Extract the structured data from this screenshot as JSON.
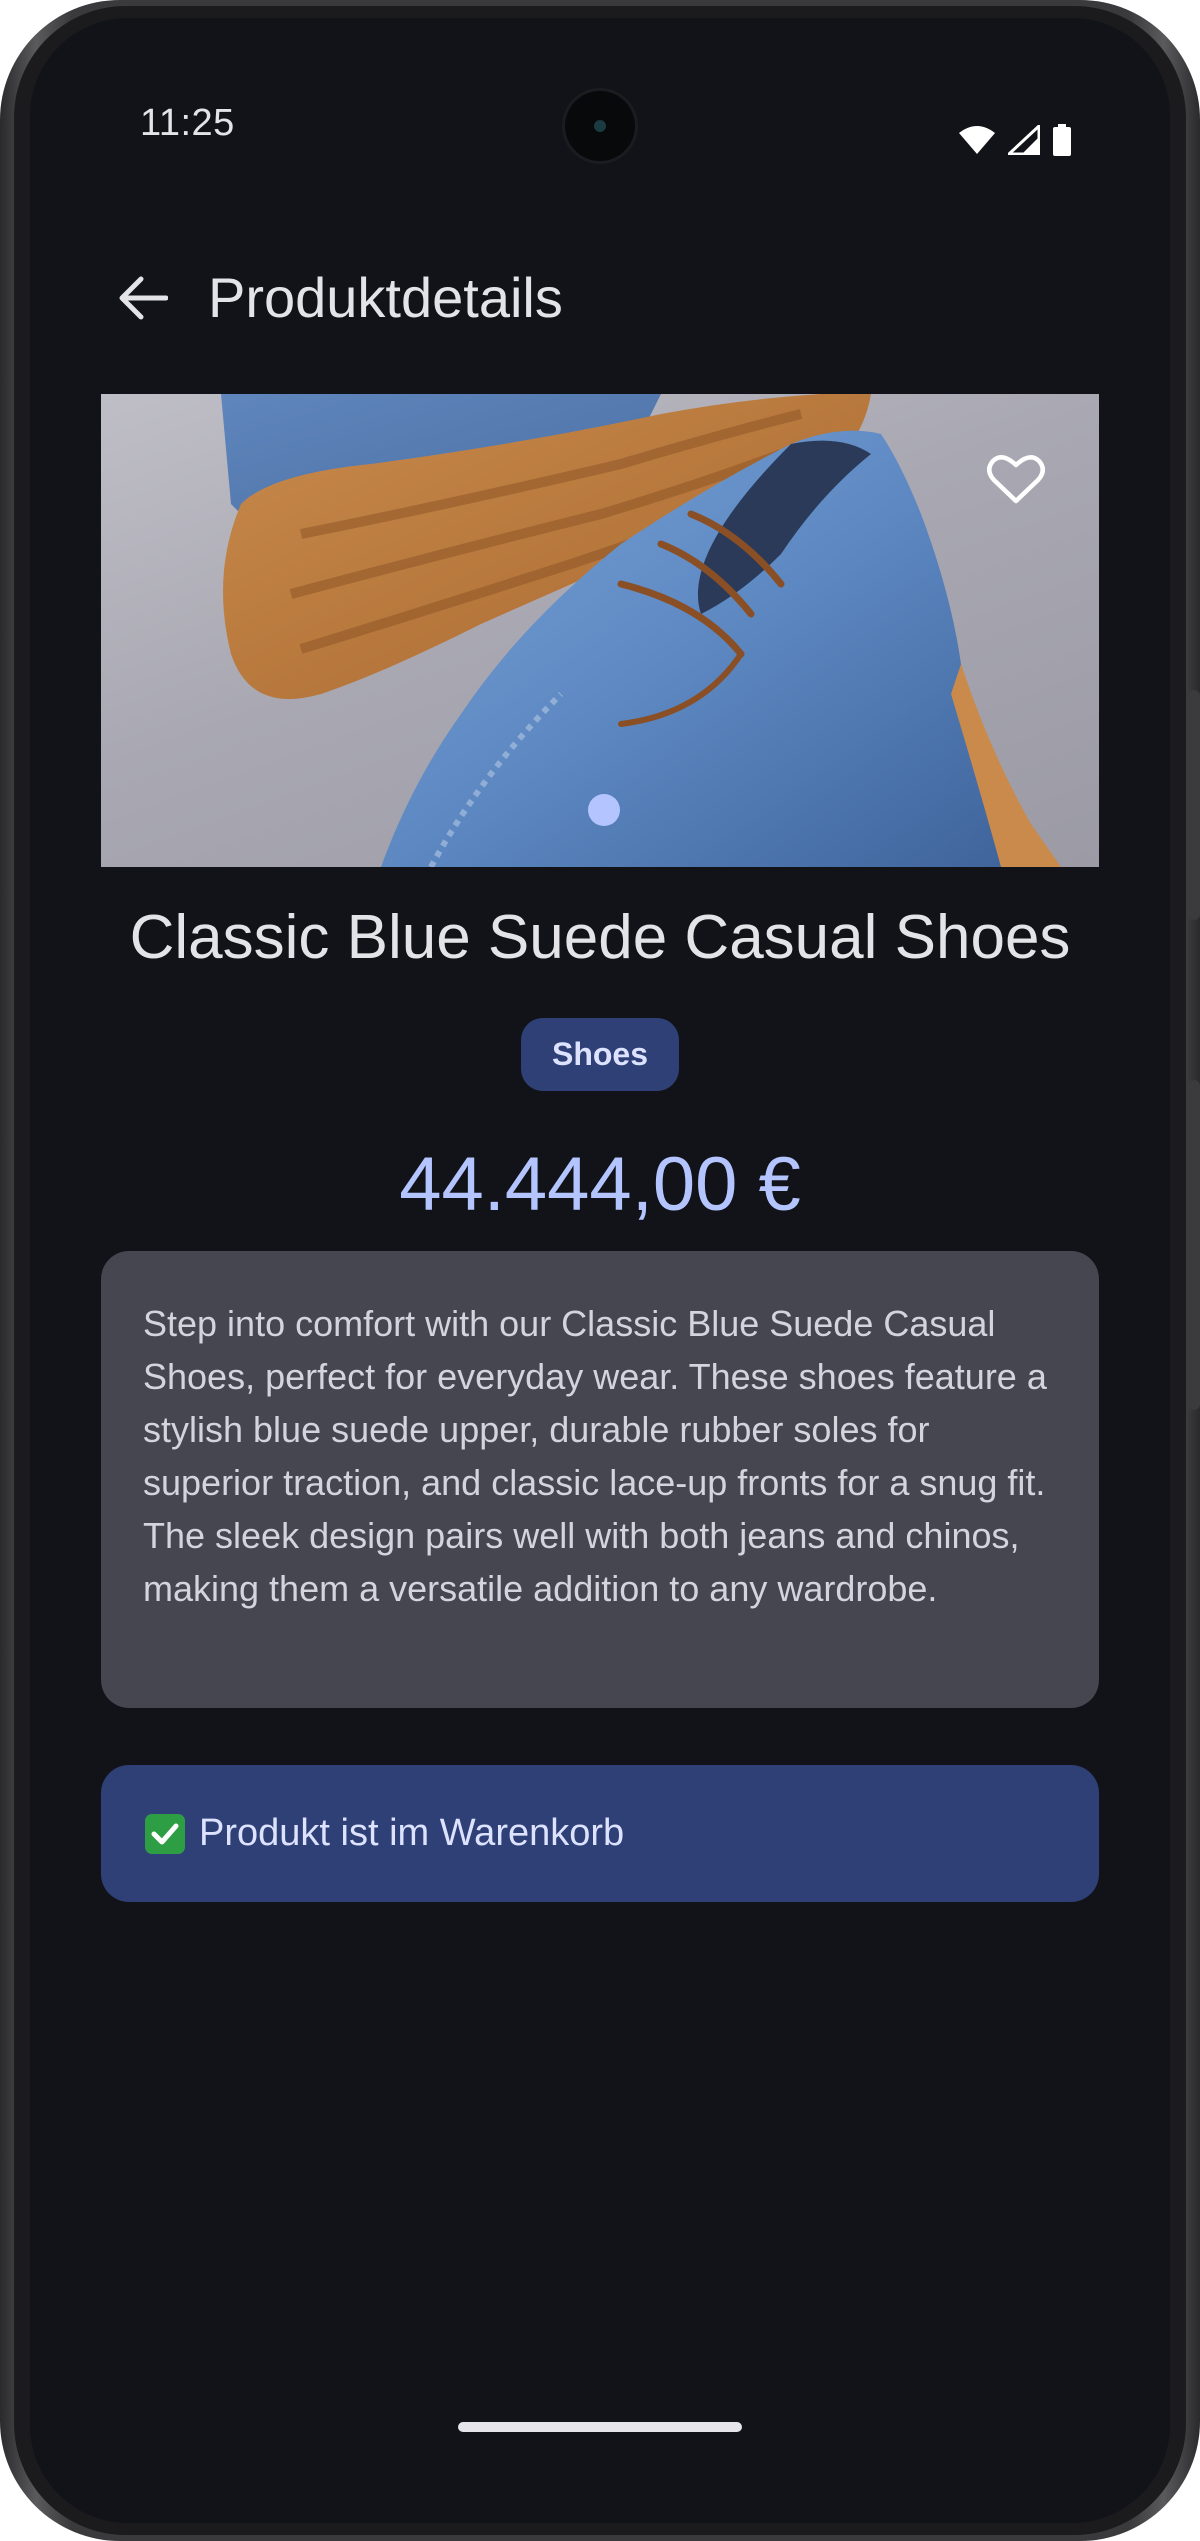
{
  "status_bar": {
    "time": "11:25",
    "icons": [
      "wifi-icon",
      "signal-icon",
      "battery-icon"
    ]
  },
  "app_bar": {
    "title": "Produktdetails",
    "back_icon": "arrow-back-icon"
  },
  "product": {
    "image_description": "blue suede casual shoes with gum rubber soles on a grey background",
    "favorite_icon": "heart-outline-icon",
    "carousel_page": 1,
    "carousel_pages": 1,
    "title": "Classic Blue Suede Casual Shoes",
    "category": "Shoes",
    "price": "44.444,00 €",
    "description": "Step into comfort with our Classic Blue Suede Casual Shoes, perfect for everyday wear. These shoes feature a stylish blue suede upper, durable rubber soles for superior traction, and classic lace-up fronts for a snug fit. The sleek design pairs well with both jeans and chinos, making them a versatile addition to any wardrobe."
  },
  "cart_status": {
    "icon": "check-mark-icon",
    "text": "Produkt ist im Warenkorb"
  },
  "colors": {
    "background": "#111318",
    "accent": "#b4c4ff",
    "chip_background": "#2f4077",
    "card_background": "#45464f"
  }
}
